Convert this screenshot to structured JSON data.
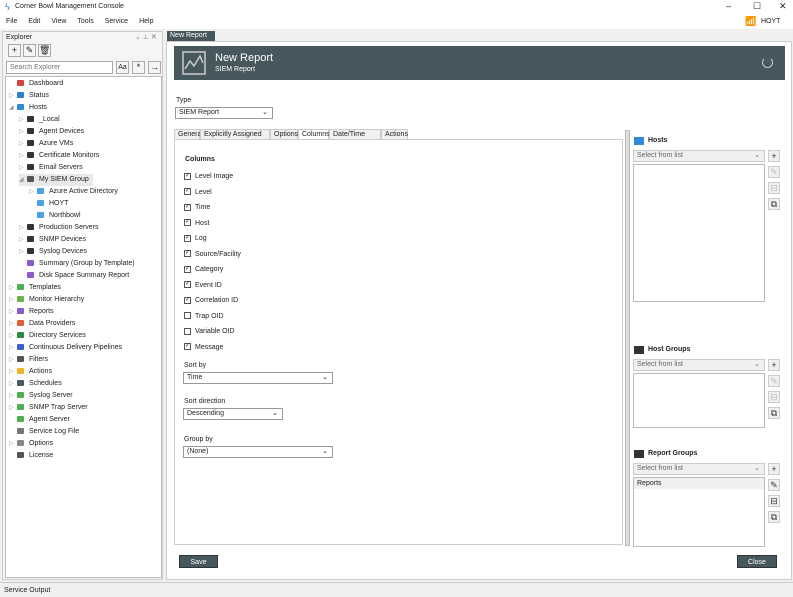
{
  "window": {
    "title": "Corner Bowl Management Console",
    "user": "HOYT"
  },
  "menu": [
    "File",
    "Edit",
    "View",
    "Tools",
    "Service",
    "Help"
  ],
  "explorer": {
    "title": "Explorer",
    "search_placeholder": "Search Explorer",
    "tree": [
      {
        "label": "Dashboard",
        "level": 0,
        "exp": "",
        "color": "#d9413b"
      },
      {
        "label": "Status",
        "level": 0,
        "exp": "▷",
        "color": "#2f7fd1"
      },
      {
        "label": "Hosts",
        "level": 0,
        "exp": "◢",
        "color": "#2f8ad8"
      },
      {
        "label": "_Local",
        "level": 1,
        "exp": "▷",
        "color": "#333"
      },
      {
        "label": "Agent Devices",
        "level": 1,
        "exp": "▷",
        "color": "#333"
      },
      {
        "label": "Azure VMs",
        "level": 1,
        "exp": "▷",
        "color": "#333"
      },
      {
        "label": "Certificate Monitors",
        "level": 1,
        "exp": "▷",
        "color": "#333"
      },
      {
        "label": "Email Servers",
        "level": 1,
        "exp": "▷",
        "color": "#333"
      },
      {
        "label": "My SIEM Group",
        "level": 1,
        "exp": "◢",
        "color": "#555",
        "selected": true
      },
      {
        "label": "Azure Active Directory",
        "level": 2,
        "exp": "▷",
        "color": "#4aa3df"
      },
      {
        "label": "HOYT",
        "level": 2,
        "exp": "",
        "color": "#4aa3df"
      },
      {
        "label": "Northbowl",
        "level": 2,
        "exp": "",
        "color": "#4aa3df"
      },
      {
        "label": "Production Servers",
        "level": 1,
        "exp": "▷",
        "color": "#333"
      },
      {
        "label": "SNMP Devices",
        "level": 1,
        "exp": "▷",
        "color": "#333"
      },
      {
        "label": "Syslog Devices",
        "level": 1,
        "exp": "▷",
        "color": "#333"
      },
      {
        "label": "Summary (Group by Template)",
        "level": 1,
        "exp": "",
        "color": "#8a5cc7"
      },
      {
        "label": "Disk Space Summary Report",
        "level": 1,
        "exp": "",
        "color": "#8a5cc7"
      },
      {
        "label": "Templates",
        "level": 0,
        "exp": "▷",
        "color": "#4caf50"
      },
      {
        "label": "Monitor Hierarchy",
        "level": 0,
        "exp": "▷",
        "color": "#6ab04c"
      },
      {
        "label": "Reports",
        "level": 0,
        "exp": "▷",
        "color": "#8a5cc7"
      },
      {
        "label": "Data Providers",
        "level": 0,
        "exp": "▷",
        "color": "#e0603a"
      },
      {
        "label": "Directory Services",
        "level": 0,
        "exp": "▷",
        "color": "#2e8b3d"
      },
      {
        "label": "Continuous Delivery Pipelines",
        "level": 0,
        "exp": "▷",
        "color": "#3a5fcd"
      },
      {
        "label": "Filters",
        "level": 0,
        "exp": "▷",
        "color": "#555"
      },
      {
        "label": "Actions",
        "level": 0,
        "exp": "▷",
        "color": "#f0b429"
      },
      {
        "label": "Schedules",
        "level": 0,
        "exp": "▷",
        "color": "#4a5a63"
      },
      {
        "label": "Syslog Server",
        "level": 0,
        "exp": "▷",
        "color": "#4caf50"
      },
      {
        "label": "SNMP Trap Server",
        "level": 0,
        "exp": "▷",
        "color": "#4caf50"
      },
      {
        "label": "Agent Server",
        "level": 0,
        "exp": "",
        "color": "#4caf50"
      },
      {
        "label": "Service Log File",
        "level": 0,
        "exp": "",
        "color": "#777"
      },
      {
        "label": "Options",
        "level": 0,
        "exp": "▷",
        "color": "#888"
      },
      {
        "label": "License",
        "level": 0,
        "exp": "",
        "color": "#555"
      }
    ]
  },
  "doc_tab": {
    "label": "New Report"
  },
  "header": {
    "title": "New Report",
    "subtitle": "SIEM Report"
  },
  "type": {
    "label": "Type",
    "value": "SIEM Report"
  },
  "tabs": [
    "General",
    "Explicitly Assigned Logs",
    "Options",
    "Columns",
    "Date/Time Range",
    "Actions"
  ],
  "active_tab": "Columns",
  "columns": {
    "heading": "Columns",
    "items": [
      {
        "label": "Level Image",
        "checked": true
      },
      {
        "label": "Level",
        "checked": true
      },
      {
        "label": "Time",
        "checked": true
      },
      {
        "label": "Host",
        "checked": true
      },
      {
        "label": "Log",
        "checked": true
      },
      {
        "label": "Source/Facility",
        "checked": true
      },
      {
        "label": "Category",
        "checked": true
      },
      {
        "label": "Event ID",
        "checked": true
      },
      {
        "label": "Correlation ID",
        "checked": true
      },
      {
        "label": "Trap OID",
        "checked": false
      },
      {
        "label": "Variable OID",
        "checked": false
      },
      {
        "label": "Message",
        "checked": true
      }
    ]
  },
  "sort_by": {
    "label": "Sort by",
    "value": "Time"
  },
  "sort_direction": {
    "label": "Sort direction",
    "value": "Descending"
  },
  "group_by": {
    "label": "Group by",
    "value": "(None)"
  },
  "right": {
    "hosts": {
      "title": "Hosts",
      "placeholder": "Select from list",
      "items": []
    },
    "host_groups": {
      "title": "Host Groups",
      "placeholder": "Select from list",
      "items": []
    },
    "report_groups": {
      "title": "Report Groups",
      "placeholder": "Select from list",
      "items": [
        "Reports"
      ]
    }
  },
  "buttons": {
    "save": "Save",
    "close": "Close"
  },
  "status_bar": {
    "label": "Service Output"
  }
}
